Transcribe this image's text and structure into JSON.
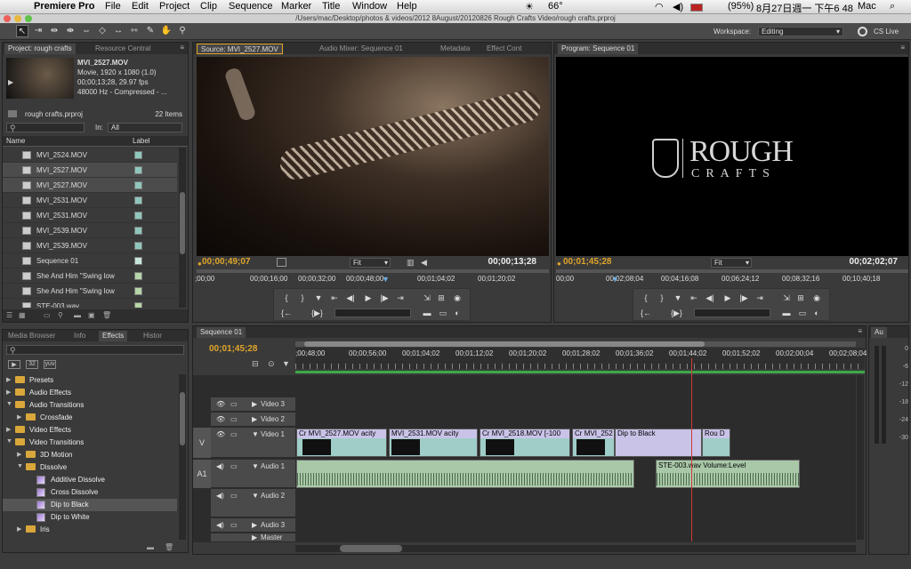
{
  "menubar": {
    "app": "Premiere Pro",
    "items": [
      "File",
      "Edit",
      "Project",
      "Clip",
      "Sequence",
      "Marker",
      "Title",
      "Window",
      "Help"
    ],
    "status": {
      "temp": "66°",
      "battery": "(95%)",
      "datetime": "8月27日週一 下午6 48",
      "user": "Mac"
    }
  },
  "titlebar": {
    "path": "/Users/mac/Desktop/photos & videos/2012 8August/20120826 Rough Crafts Video/rough crafts.prproj"
  },
  "toolbar": {
    "workspace_label": "Workspace:",
    "workspace_value": "Editing",
    "cs_live": "CS Live"
  },
  "project": {
    "tabs": [
      "Project: rough crafts",
      "Resource Central"
    ],
    "clip": {
      "name": "MVI_2527.MOV",
      "line1": "Movie, 1920 x 1080 (1.0)",
      "line2": "00;00;13;28, 29.97 fps",
      "line3": "48000 Hz - Compressed - ..."
    },
    "file": "rough crafts.prproj",
    "count": "22 Items",
    "in_label": "In:",
    "in_value": "All",
    "col_name": "Name",
    "col_label": "Label",
    "items": [
      {
        "name": "MVI_2524.MOV",
        "color": "#8fc7bd"
      },
      {
        "name": "MVI_2527.MOV",
        "color": "#8fc7bd"
      },
      {
        "name": "MVI_2527.MOV",
        "color": "#8fc7bd"
      },
      {
        "name": "MVI_2531.MOV",
        "color": "#8fc7bd"
      },
      {
        "name": "MVI_2531.MOV",
        "color": "#8fc7bd"
      },
      {
        "name": "MVI_2539.MOV",
        "color": "#8fc7bd"
      },
      {
        "name": "MVI_2539.MOV",
        "color": "#8fc7bd"
      },
      {
        "name": "Sequence 01",
        "color": "#c9e6dc"
      },
      {
        "name": "She And Him \"Swing low",
        "color": "#b7d6a8"
      },
      {
        "name": "She And Him \"Swing low",
        "color": "#b7d6a8"
      },
      {
        "name": "STE-003.wav",
        "color": "#b7d6a8"
      }
    ]
  },
  "source": {
    "tabs": [
      "Source: MVI_2527.MOV",
      "Audio Mixer: Sequence 01",
      "Metadata",
      "Effect Cont"
    ],
    "tc_left": "00;00;49;07",
    "tc_right": "00;00;13;28",
    "fit": "Fit",
    "ruler": [
      ";00;00",
      "00;00;16;00",
      "00;00;32;00",
      "00;00;48;00",
      "00;01;04;02",
      "00;01;20;02"
    ]
  },
  "program": {
    "tabs": [
      "Program: Sequence 01"
    ],
    "tc_left": "00;01;45;28",
    "tc_right": "00;02;02;07",
    "fit": "Fit",
    "logo_line1": "ROUGH",
    "logo_line2": "CRAFTS",
    "ruler": [
      "00;00",
      "00;02;08;04",
      "00;04;16;08",
      "00;06;24;12",
      "00;08;32;16",
      "00;10;40;18"
    ]
  },
  "effects": {
    "tabs": [
      "Media Browser",
      "Info",
      "Effects",
      "Histor"
    ],
    "items": [
      {
        "label": "Presets",
        "indent": 0,
        "type": "folder"
      },
      {
        "label": "Audio Effects",
        "indent": 0,
        "type": "folder"
      },
      {
        "label": "Audio Transitions",
        "indent": 0,
        "type": "folder"
      },
      {
        "label": "Crossfade",
        "indent": 1,
        "type": "folder"
      },
      {
        "label": "Video Effects",
        "indent": 0,
        "type": "folder"
      },
      {
        "label": "Video Transitions",
        "indent": 0,
        "type": "folder"
      },
      {
        "label": "3D Motion",
        "indent": 1,
        "type": "folder"
      },
      {
        "label": "Dissolve",
        "indent": 1,
        "type": "folder"
      },
      {
        "label": "Additive Dissolve",
        "indent": 2,
        "type": "fx"
      },
      {
        "label": "Cross Dissolve",
        "indent": 2,
        "type": "fx"
      },
      {
        "label": "Dip to Black",
        "indent": 2,
        "type": "fx"
      },
      {
        "label": "Dip to White",
        "indent": 2,
        "type": "fx"
      },
      {
        "label": "Iris",
        "indent": 1,
        "type": "folder"
      }
    ]
  },
  "timeline": {
    "tab": "Sequence 01",
    "tc": "00;01;45;28",
    "ruler": [
      ";00;48;00",
      "00;00;56;00",
      "00;01;04;02",
      "00;01;12;02",
      "00;01;20;02",
      "00;01;28;02",
      "00;01;36;02",
      "00;01;44;02",
      "00;01;52;02",
      "00;02;00;04",
      "00;02;08;04"
    ],
    "tracks": {
      "v3": "Video 3",
      "v2": "Video 2",
      "v1": "Video 1",
      "a1": "Audio 1",
      "a2": "Audio 2",
      "a3": "Audio 3",
      "master": "Master",
      "v_label": "V",
      "a1_label": "A1"
    },
    "video_clips": [
      "Cr",
      "MVI_2527.MOV",
      "acity",
      "MVI_2531.MOV",
      "acity",
      "Cr",
      "MVI_2518.MOV [-100",
      "Cr",
      "MVI_252",
      "Dip to Black",
      "Rou",
      "D"
    ],
    "audio_clips": [
      "STE-003.wav",
      "Volume:Level"
    ]
  },
  "audio_meter": {
    "label": "Au",
    "ticks": [
      "0",
      "-6",
      "-12",
      "-18",
      "-24",
      "-30"
    ]
  }
}
